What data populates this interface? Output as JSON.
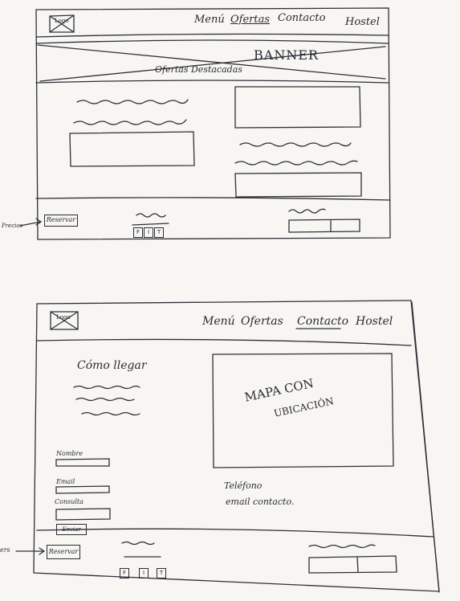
{
  "sketch1": {
    "logo_label": "Logo",
    "nav": [
      "Menú",
      "Ofertas",
      "Contacto",
      "Hostel"
    ],
    "banner": "BANNER",
    "featured": "Ofertas Destacadas",
    "side_note": "Precios",
    "reserve_button": "Reservar",
    "social": [
      "F",
      "I",
      "T"
    ]
  },
  "sketch2": {
    "logo_label": "Logo",
    "nav": [
      "Menú",
      "Ofertas",
      "Contacto",
      "Hostel"
    ],
    "section_title": "Cómo llegar",
    "map_label_line1": "MAPA CON",
    "map_label_line2": "UBICACIÓN",
    "form": {
      "name_label": "Nombre",
      "email_label": "Email",
      "message_label": "Consulta",
      "submit_label": "Enviar"
    },
    "contact_phone": "Teléfono",
    "contact_email": "email contacto.",
    "side_note": "ers",
    "reserve_button": "Reservar",
    "social": [
      "F",
      "I",
      "T"
    ]
  }
}
